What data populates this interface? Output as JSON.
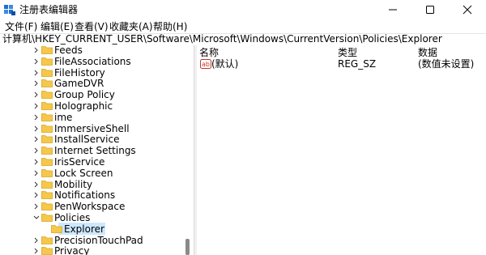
{
  "window": {
    "title": "注册表编辑器",
    "controls": {
      "minimize": "minimize-icon",
      "maximize": "maximize-icon",
      "close": "close-icon"
    }
  },
  "menu": [
    "文件(F)",
    "编辑(E)",
    "查看(V)",
    "收藏夹(A)",
    "帮助(H)"
  ],
  "address": "计算机\\HKEY_CURRENT_USER\\Software\\Microsoft\\Windows\\CurrentVersion\\Policies\\Explorer",
  "tree": [
    {
      "label": "Feeds",
      "expanded": false
    },
    {
      "label": "FileAssociations",
      "expanded": false
    },
    {
      "label": "FileHistory",
      "expanded": false
    },
    {
      "label": "GameDVR",
      "expanded": false
    },
    {
      "label": "Group Policy",
      "expanded": false
    },
    {
      "label": "Holographic",
      "expanded": false
    },
    {
      "label": "ime",
      "expanded": false
    },
    {
      "label": "ImmersiveShell",
      "expanded": false
    },
    {
      "label": "InstallService",
      "expanded": false
    },
    {
      "label": "Internet Settings",
      "expanded": false
    },
    {
      "label": "IrisService",
      "expanded": false
    },
    {
      "label": "Lock Screen",
      "expanded": false
    },
    {
      "label": "Mobility",
      "expanded": false
    },
    {
      "label": "Notifications",
      "expanded": false
    },
    {
      "label": "PenWorkspace",
      "expanded": false
    },
    {
      "label": "Policies",
      "expanded": true
    },
    {
      "label": "Explorer",
      "child": true,
      "selected": true
    },
    {
      "label": "PrecisionTouchPad",
      "expanded": false
    },
    {
      "label": "Privacy",
      "expanded": false
    }
  ],
  "values_pane": {
    "headers": {
      "name": "名称",
      "type": "类型",
      "data": "数据"
    },
    "rows": [
      {
        "name": "(默认)",
        "type": "REG_SZ",
        "data": "(数值未设置)",
        "icon": "string-value-icon"
      }
    ]
  },
  "colors": {
    "folder": "#f5c84c",
    "selection": "#cce8ff",
    "accent": "#1f6fd1"
  }
}
